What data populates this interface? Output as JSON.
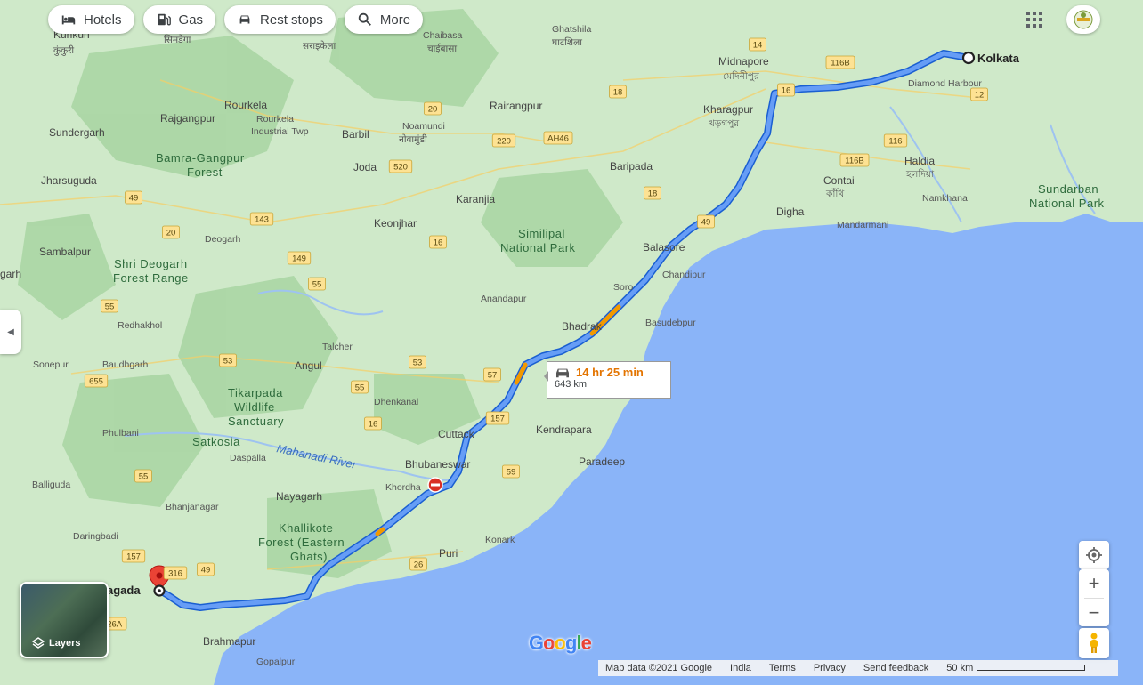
{
  "chips": [
    {
      "label": "Hotels",
      "icon": "bed-icon"
    },
    {
      "label": "Gas",
      "icon": "gas-pump-icon"
    },
    {
      "label": "Rest stops",
      "icon": "car-icon"
    },
    {
      "label": "More",
      "icon": "search-icon"
    }
  ],
  "route": {
    "duration": "14 hr 25 min",
    "distance": "643 km",
    "origin": "Kolkata",
    "destination": "agada"
  },
  "places": {
    "kunkuri": "Kunkuri",
    "kunkuri_native": "कुंकुरी",
    "simdega": "सिमडेगा",
    "chaibasa": "Chaibasa",
    "chaibasa_native": "चाईबासा",
    "saraikela": "सराइकेला",
    "ghatshila": "Ghatshila",
    "ghatshila_native": "घाटशिला",
    "midnapore": "Midnapore",
    "midnapore_native": "মেদিনীপুর",
    "kharagpur": "Kharagpur",
    "kharagpur_native": "খড়গপুর",
    "diamond_harbour": "Diamond Harbour",
    "rourkela": "Rourkela",
    "rourkela_industrial": "Rourkela",
    "industrial_twp": "Industrial Twp",
    "rajgangpur": "Rajgangpur",
    "barbil": "Barbil",
    "noamundi": "Noamundi",
    "noamundi_native": "नोवामुंडी",
    "rairangpur": "Rairangpur",
    "sundergarh": "Sundergarh",
    "bamra_gangpur": "Bamra-Gangpur",
    "forest": "Forest",
    "joda": "Joda",
    "baripada": "Baripada",
    "haldia": "Haldia",
    "haldia_native": "হলদিয়া",
    "jharsuguda": "Jharsuguda",
    "karanjia": "Karanjia",
    "contai": "Contai",
    "contai_native": "কাঁথি",
    "sundarban": "Sundarban",
    "national_park": "National Park",
    "namkhana": "Namkhana",
    "keonjhar": "Keonjhar",
    "similipal": "Similipal",
    "similipal_np": "National Park",
    "digha": "Digha",
    "mandarmani": "Mandarmani",
    "balasore": "Balasore",
    "deogarh": "Deogarh",
    "sambalpur": "Sambalpur",
    "garh": "garh",
    "shri_deogarh": "Shri Deogarh",
    "forest_range": "Forest Range",
    "chandipur": "Chandipur",
    "soro": "Soro",
    "anandapur": "Anandapur",
    "basudebpur": "Basudebpur",
    "bhadrak": "Bhadrak",
    "redhakhol": "Redhakhol",
    "talcher": "Talcher",
    "angul": "Angul",
    "sonepur": "Sonepur",
    "baudhgarh": "Baudhgarh",
    "tikarpada": "Tikarpada",
    "wildlife": "Wildlife",
    "sanctuary": "Sanctuary",
    "dhenkanal": "Dhenkanal",
    "phulbani": "Phulbani",
    "satkosia": "Satkosia",
    "cuttack": "Cuttack",
    "kendrapara": "Kendrapara",
    "daspalla": "Daspalla",
    "mahanadi": "Mahanadi River",
    "bhubaneswar": "Bhubaneswar",
    "paradeep": "Paradeep",
    "balliguda": "Balliguda",
    "khordha": "Khordha",
    "nayagarh": "Nayagarh",
    "bhanjanagar": "Bhanjanagar",
    "khallikote": "Khallikote",
    "forest_eastern": "Forest (Eastern",
    "ghats": "Ghats)",
    "daringbadi": "Daringbadi",
    "konark": "Konark",
    "puri": "Puri",
    "brahmapur": "Brahmapur",
    "gopalpur": "Gopalpur"
  },
  "shields": [
    "14",
    "116B",
    "16",
    "12",
    "18",
    "20",
    "220",
    "AH46",
    "116",
    "116B",
    "520",
    "18",
    "143",
    "49",
    "20",
    "16",
    "49",
    "149",
    "55",
    "55",
    "53",
    "55",
    "53",
    "57",
    "655",
    "16",
    "157",
    "55",
    "59",
    "157",
    "49",
    "316",
    "26",
    "326A"
  ],
  "controls": {
    "layers_label": "Layers",
    "zoom_in": "+",
    "zoom_out": "−"
  },
  "footer": {
    "map_data": "Map data ©2021 Google",
    "region": "India",
    "terms": "Terms",
    "privacy": "Privacy",
    "feedback": "Send feedback",
    "scale": "50 km"
  },
  "brand": {
    "logo": [
      "G",
      "o",
      "o",
      "g",
      "l",
      "e"
    ],
    "route_color": "#4285f4",
    "traffic_color": "#f29900",
    "land_color": "#cfe9c9",
    "water_color": "#8ab4f8"
  }
}
